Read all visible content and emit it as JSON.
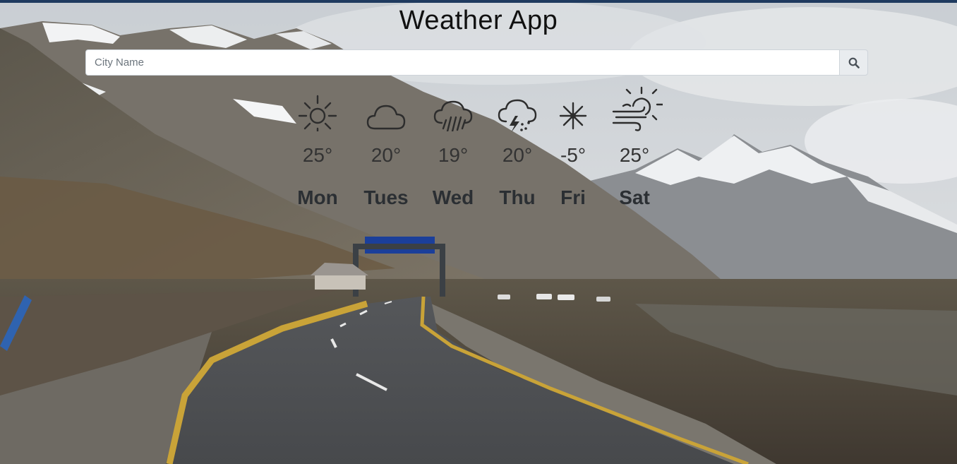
{
  "app": {
    "title": "Weather App"
  },
  "search": {
    "placeholder": "City Name",
    "value": ""
  },
  "forecast": [
    {
      "day": "Mon",
      "temp": "25°",
      "icon": "sun-icon"
    },
    {
      "day": "Tues",
      "temp": "20°",
      "icon": "cloud-icon"
    },
    {
      "day": "Wed",
      "temp": "19°",
      "icon": "rain-icon"
    },
    {
      "day": "Thu",
      "temp": "20°",
      "icon": "thunderstorm-icon"
    },
    {
      "day": "Fri",
      "temp": "-5°",
      "icon": "snowflake-icon"
    },
    {
      "day": "Sat",
      "temp": "25°",
      "icon": "windy-sun-icon"
    }
  ],
  "colors": {
    "top_bar": "#1f3a5f",
    "text": "#111111",
    "day_text": "#2b2f33"
  }
}
